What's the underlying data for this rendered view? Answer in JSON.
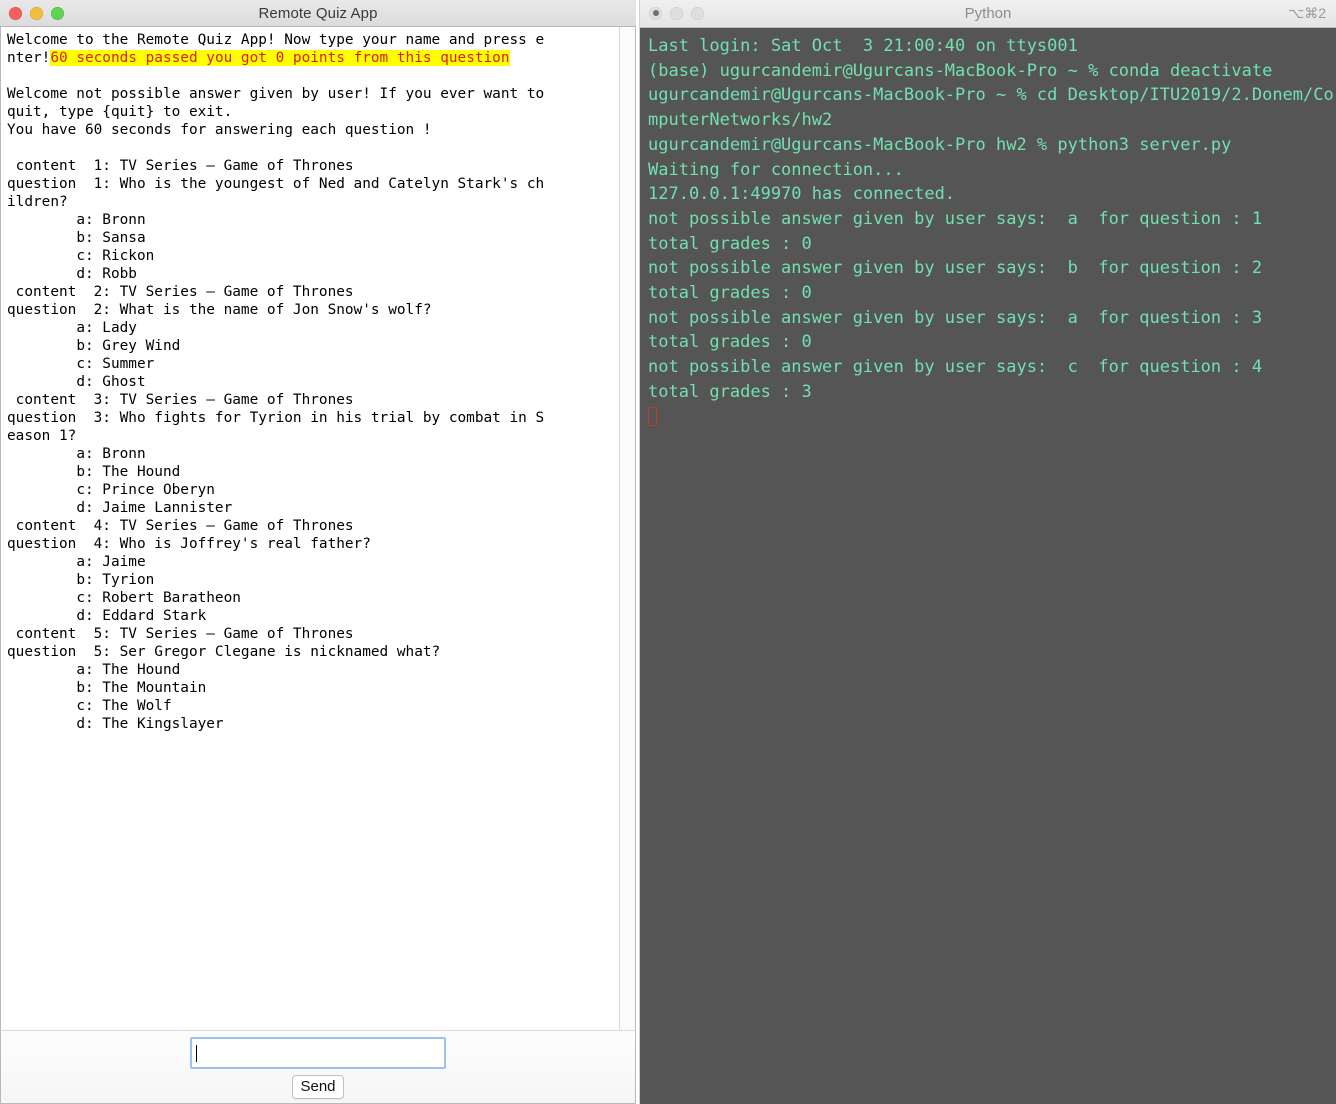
{
  "quiz_window": {
    "title": "Remote Quiz App",
    "traffic_lights": [
      "close-red",
      "minimize-yellow",
      "zoom-green"
    ],
    "transcript": {
      "welcome_line_part1": "Welcome to the Remote Quiz App! Now type your name and press e\nnter!",
      "timeout_highlight": "60 seconds passed you got 0 points from this question",
      "after_highlight": "\n\nWelcome not possible answer given by user! If you ever want to\nquit, type {quit} to exit.\nYou have 60 seconds for answering each question !\n\n",
      "questions": [
        {
          "content_line": " content  1: TV Series – Game of Thrones",
          "question_line": "question  1: Who is the youngest of Ned and Catelyn Stark's ch\nildren?",
          "options": [
            "\ta: Bronn",
            "\tb: Sansa",
            "\tc: Rickon",
            "\td: Robb"
          ]
        },
        {
          "content_line": " content  2: TV Series – Game of Thrones",
          "question_line": "question  2: What is the name of Jon Snow's wolf?",
          "options": [
            "\ta: Lady",
            "\tb: Grey Wind",
            "\tc: Summer",
            "\td: Ghost"
          ]
        },
        {
          "content_line": " content  3: TV Series – Game of Thrones",
          "question_line": "question  3: Who fights for Tyrion in his trial by combat in S\neason 1?",
          "options": [
            "\ta: Bronn",
            "\tb: The Hound",
            "\tc: Prince Oberyn",
            "\td: Jaime Lannister"
          ]
        },
        {
          "content_line": " content  4: TV Series – Game of Thrones",
          "question_line": "question  4: Who is Joffrey's real father?",
          "options": [
            "\ta: Jaime",
            "\tb: Tyrion",
            "\tc: Robert Baratheon",
            "\td: Eddard Stark"
          ]
        },
        {
          "content_line": " content  5: TV Series – Game of Thrones",
          "question_line": "question  5: Ser Gregor Clegane is nicknamed what?",
          "options": [
            "\ta: The Hound",
            "\tb: The Mountain",
            "\tc: The Wolf",
            "\td: The Kingslayer"
          ]
        }
      ]
    },
    "answer_input": {
      "value": "",
      "placeholder": ""
    },
    "send_button_label": "Send",
    "colors": {
      "highlight_bg": "#ffff00",
      "highlight_fg": "#e01b10",
      "input_focus_border": "#9ec2f0"
    }
  },
  "terminal_window": {
    "title": "Python",
    "shortcut": "⌥⌘2",
    "traffic_lights": [
      "close-inactive",
      "minimize-inactive",
      "zoom-inactive"
    ],
    "colors": {
      "background": "#555555",
      "text": "#72e0b0",
      "cursor_outline": "#c0392b"
    },
    "lines": [
      "Last login: Sat Oct  3 21:00:40 on ttys001",
      "(base) ugurcandemir@Ugurcans-MacBook-Pro ~ % conda deactivate",
      "ugurcandemir@Ugurcans-MacBook-Pro ~ % cd Desktop/ITU2019/2.Donem/ComputerNetworks/hw2",
      "ugurcandemir@Ugurcans-MacBook-Pro hw2 % python3 server.py",
      "Waiting for connection...",
      "127.0.0.1:49970 has connected.",
      "not possible answer given by user says:  a  for question : 1",
      "total grades : 0",
      "not possible answer given by user says:  b  for question : 2",
      "total grades : 0",
      "not possible answer given by user says:  a  for question : 3",
      "total grades : 0",
      "not possible answer given by user says:  c  for question : 4",
      "total grades : 3"
    ]
  }
}
